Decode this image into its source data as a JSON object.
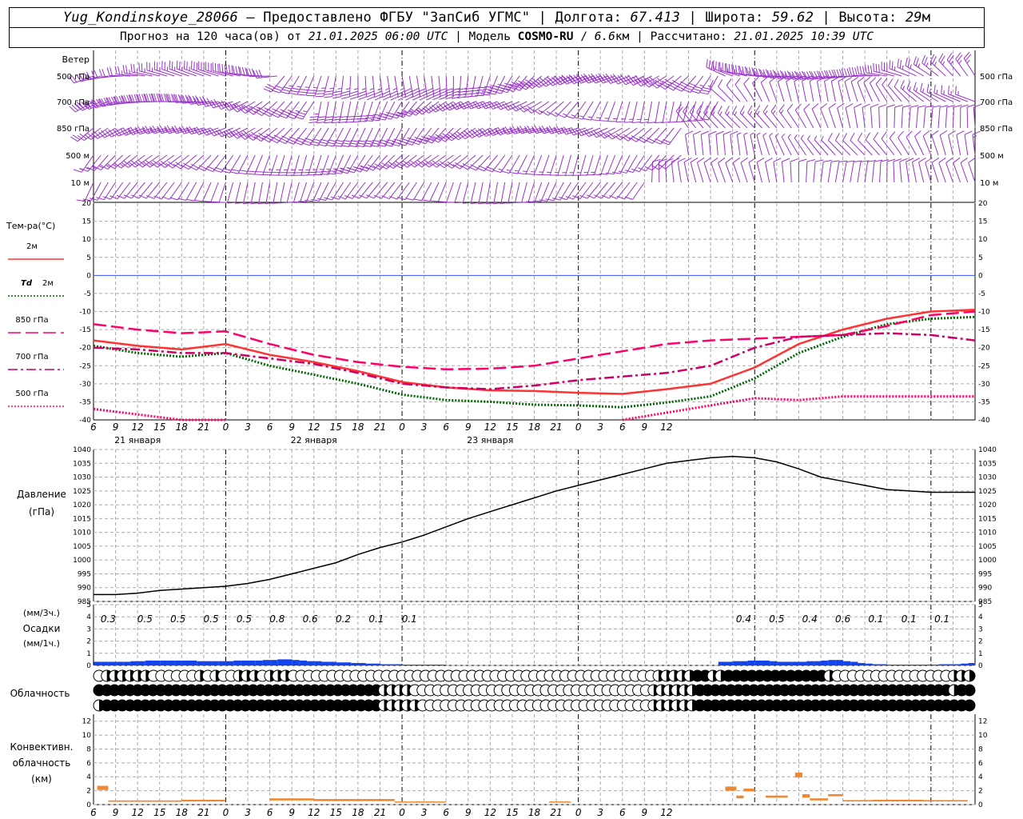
{
  "header": {
    "station": "Yug_Kondinskoye_28066",
    "dash": " – ",
    "provider": "Предоставлено ФГБУ \"ЗапСиб УГМС\"",
    "lon_label": "Долгота:",
    "lon": "67.413",
    "lat_label": "Широта:",
    "lat": "59.62",
    "alt_label": "Высота:",
    "alt": "29",
    "alt_unit": "м",
    "forecast_label": "Прогноз на 120 часа(ов) от",
    "issued": "21.01.2025 06:00 UTC",
    "model_label": "Модель",
    "model": "COSMO-RU",
    "resolution": "6.6",
    "res_unit": "км",
    "computed_label": "Рассчитано:",
    "computed": "21.01.2025 10:39 UTC"
  },
  "axis": {
    "hours_label": [
      "6",
      "9",
      "12",
      "15",
      "18",
      "21",
      "0",
      "3",
      "6",
      "9",
      "12",
      "15",
      "18",
      "21",
      "0",
      "3",
      "6",
      "9",
      "12",
      "15",
      "18",
      "21",
      "0",
      "3",
      "6",
      "9",
      "12"
    ],
    "day_labels": [
      "21 января",
      "22 января",
      "23 января"
    ]
  },
  "chart_data": [
    {
      "type": "wind_barbs",
      "title": "Ветер",
      "levels": [
        "500 гПа",
        "700 гПа",
        "850 гПа",
        "500 м",
        "10 м"
      ],
      "color": "#9933cc"
    },
    {
      "type": "line",
      "title": "Тем-ра(°C)",
      "ylim": [
        -40,
        20
      ],
      "yticks": [
        20,
        15,
        10,
        5,
        0,
        -5,
        -10,
        -15,
        -20,
        -25,
        -30,
        -35,
        -40
      ],
      "x_hours": [
        0,
        6,
        12,
        18,
        24,
        30,
        36,
        42,
        48,
        54,
        60,
        66,
        72,
        78,
        84,
        90,
        96,
        102,
        108,
        114,
        120
      ],
      "series": [
        {
          "name": "2м",
          "color": "#ff3333",
          "style": "solid",
          "values": [
            -18,
            -19.5,
            -20.5,
            -19,
            -22,
            -24,
            -26.5,
            -29.5,
            -31,
            -31.8,
            -32,
            -32.5,
            -32.8,
            -31.5,
            -30,
            -25.5,
            -19,
            -15,
            -12,
            -10,
            -9.5
          ]
        },
        {
          "name": "Td",
          "suffix": "2м",
          "color": "#006600",
          "style": "dotted",
          "values": [
            -19.5,
            -21.5,
            -22.5,
            -21.5,
            -25,
            -27.5,
            -30,
            -33,
            -34.5,
            -35,
            -35.8,
            -36,
            -36.5,
            -35.2,
            -33.5,
            -28.5,
            -21.5,
            -17,
            -13.5,
            -12,
            -11.5
          ]
        },
        {
          "name": "850 гПа",
          "color": "#ff0066",
          "style": "longdash",
          "values": [
            -13.5,
            -15,
            -16,
            -15.5,
            -19,
            -22,
            -24,
            -25.3,
            -26,
            -25.8,
            -25,
            -23,
            -21,
            -19,
            -18,
            -17.5,
            -17,
            -16.5,
            -14,
            -11,
            -10
          ]
        },
        {
          "name": "700 гПа",
          "color": "#cc0066",
          "style": "dashdot",
          "values": [
            -20,
            -20.5,
            -21.5,
            -21.5,
            -23,
            -24.5,
            -27,
            -30,
            -31,
            -31.5,
            -30.5,
            -29,
            -28,
            -27,
            -25,
            -20,
            -17,
            -16.5,
            -16,
            -16.5,
            -18
          ]
        },
        {
          "name": "500 гПа",
          "color": "#ff0066",
          "style": "dotted",
          "values": [
            -37,
            -38.5,
            -40,
            -40,
            null,
            null,
            null,
            null,
            null,
            null,
            null,
            null,
            -40,
            -38,
            -36,
            -34,
            -34.5,
            -33.5,
            -33.5,
            -33.5,
            -33.5
          ]
        }
      ]
    },
    {
      "type": "line",
      "title": "Давление",
      "unit": "(гПа)",
      "ylim": [
        985,
        1040
      ],
      "yticks": [
        1040,
        1035,
        1030,
        1025,
        1020,
        1015,
        1010,
        1005,
        1000,
        995,
        990,
        985
      ],
      "x_hours": [
        0,
        3,
        6,
        9,
        12,
        15,
        18,
        21,
        24,
        27,
        30,
        33,
        36,
        39,
        42,
        45,
        48,
        51,
        54,
        57,
        60,
        63,
        66,
        69,
        72,
        75,
        78,
        81,
        84,
        87,
        90,
        93,
        96,
        99,
        102,
        105,
        108,
        111,
        114,
        117,
        120
      ],
      "series": [
        {
          "name": "Давление",
          "color": "#000000",
          "values": [
            987.5,
            987.5,
            988,
            989,
            989.5,
            990,
            990.5,
            991.5,
            993,
            995,
            997,
            999,
            1002,
            1004.5,
            1006.5,
            1009,
            1012,
            1015,
            1017.5,
            1020,
            1022.5,
            1025,
            1027,
            1029,
            1031,
            1033,
            1035,
            1036,
            1037,
            1037.5,
            1037,
            1035.5,
            1033,
            1030,
            1028.5,
            1027,
            1025.5,
            1025,
            1024.5,
            1024.5,
            1024.5
          ]
        }
      ]
    },
    {
      "type": "bar",
      "title": "Осадки",
      "unit_3h": "(мм/3ч.)",
      "unit_1h": "(мм/1ч.)",
      "ylim": [
        0,
        5
      ],
      "yticks": [
        5,
        4,
        3,
        2,
        1,
        0
      ],
      "amounts_3h": [
        {
          "x": 2,
          "label": "0.3"
        },
        {
          "x": 7,
          "label": "0.5"
        },
        {
          "x": 11.5,
          "label": "0.5"
        },
        {
          "x": 16,
          "label": "0.5"
        },
        {
          "x": 20.5,
          "label": "0.5"
        },
        {
          "x": 25,
          "label": "0.8"
        },
        {
          "x": 29.5,
          "label": "0.6"
        },
        {
          "x": 34,
          "label": "0.2"
        },
        {
          "x": 38.5,
          "label": "0.1"
        },
        {
          "x": 43,
          "label": "0.1"
        },
        {
          "x": 88.5,
          "label": "0.4"
        },
        {
          "x": 93,
          "label": "0.5"
        },
        {
          "x": 97.5,
          "label": "0.4"
        },
        {
          "x": 102,
          "label": "0.6"
        },
        {
          "x": 106.5,
          "label": "0.1"
        },
        {
          "x": 111,
          "label": "0.1"
        },
        {
          "x": 115.5,
          "label": "0.1"
        }
      ],
      "color": "#1144ee",
      "x_hours": [
        1,
        2,
        3,
        4,
        5,
        6,
        7,
        8,
        9,
        10,
        11,
        12,
        13,
        14,
        15,
        16,
        17,
        18,
        19,
        20,
        21,
        22,
        23,
        24,
        25,
        26,
        27,
        28,
        29,
        30,
        31,
        32,
        33,
        34,
        35,
        36,
        37,
        38,
        39,
        40,
        41,
        42,
        43,
        44,
        45,
        46,
        47,
        48,
        86,
        87,
        88,
        89,
        90,
        91,
        92,
        93,
        94,
        95,
        96,
        97,
        98,
        99,
        100,
        101,
        102,
        103,
        104,
        105,
        106,
        107,
        108,
        109,
        110,
        111,
        112,
        113,
        114,
        115,
        116,
        117,
        118,
        119,
        120
      ],
      "values": [
        0.3,
        0.3,
        0.3,
        0.3,
        0.3,
        0.35,
        0.35,
        0.4,
        0.4,
        0.4,
        0.4,
        0.4,
        0.4,
        0.4,
        0.35,
        0.35,
        0.35,
        0.35,
        0.35,
        0.4,
        0.4,
        0.4,
        0.4,
        0.45,
        0.45,
        0.5,
        0.5,
        0.45,
        0.4,
        0.35,
        0.35,
        0.3,
        0.3,
        0.25,
        0.25,
        0.2,
        0.2,
        0.15,
        0.15,
        0.1,
        0.1,
        0.1,
        0.05,
        0.05,
        0.03,
        0.03,
        0.02,
        0.02,
        0.3,
        0.3,
        0.35,
        0.35,
        0.4,
        0.4,
        0.4,
        0.35,
        0.3,
        0.3,
        0.3,
        0.3,
        0.35,
        0.35,
        0.4,
        0.45,
        0.45,
        0.35,
        0.3,
        0.2,
        0.15,
        0.1,
        0.1,
        0.05,
        0.05,
        0.05,
        0.05,
        0.05,
        0.05,
        0.05,
        0.1,
        0.1,
        0.1,
        0.15,
        0.2
      ]
    },
    {
      "type": "cloud_symbols",
      "title": "Облачность",
      "rows": 3,
      "legend": "0 = ясно, 1 = частично (левая/правая половина), 2 = сплошная",
      "upper": [
        0,
        1,
        1,
        1,
        1,
        1,
        1,
        0,
        0,
        0,
        0,
        0,
        0,
        1,
        0,
        1,
        0,
        0,
        1,
        1,
        1,
        0,
        1,
        1,
        1,
        0,
        0,
        0,
        0,
        0,
        0,
        0,
        0,
        0,
        0,
        0,
        0,
        0,
        0,
        0,
        0,
        0,
        0,
        0,
        0,
        0,
        0,
        0,
        0,
        0,
        0,
        0,
        0,
        0,
        0,
        0,
        0,
        0,
        0,
        0,
        0,
        0,
        0,
        0,
        0,
        0,
        0,
        0,
        0,
        0,
        0,
        0,
        1,
        1,
        1,
        1,
        1,
        2,
        2,
        1,
        1,
        2,
        2,
        2,
        2,
        2,
        2,
        2,
        2,
        2,
        2,
        2,
        2,
        2,
        1,
        0,
        0,
        0,
        0,
        0,
        0,
        0,
        0,
        0,
        0,
        0,
        0,
        0,
        0,
        0,
        1,
        1,
        1
      ],
      "middle": [
        2,
        2,
        2,
        2,
        2,
        2,
        2,
        2,
        2,
        2,
        2,
        2,
        2,
        2,
        2,
        2,
        2,
        2,
        2,
        2,
        2,
        2,
        2,
        2,
        2,
        2,
        2,
        2,
        2,
        2,
        2,
        2,
        2,
        2,
        2,
        2,
        2,
        1,
        1,
        1,
        1,
        0,
        0,
        0,
        0,
        0,
        0,
        0,
        0,
        0,
        0,
        0,
        0,
        0,
        0,
        0,
        0,
        0,
        0,
        0,
        0,
        0,
        0,
        0,
        0,
        0,
        0,
        0,
        0,
        0,
        0,
        0,
        1,
        1,
        1,
        1,
        1,
        1,
        2,
        2,
        2,
        2,
        2,
        2,
        2,
        2,
        2,
        2,
        2,
        2,
        2,
        2,
        2,
        2,
        2,
        2,
        2,
        2,
        2,
        2,
        2,
        2,
        2,
        2,
        2,
        2,
        2,
        2,
        2,
        2,
        2,
        1,
        2,
        2
      ],
      "lower": [
        1,
        2,
        2,
        2,
        2,
        2,
        2,
        2,
        2,
        2,
        2,
        2,
        2,
        2,
        2,
        2,
        2,
        2,
        2,
        2,
        2,
        2,
        2,
        2,
        2,
        2,
        2,
        2,
        2,
        2,
        2,
        2,
        2,
        2,
        2,
        2,
        2,
        1,
        1,
        1,
        1,
        1,
        0,
        0,
        0,
        0,
        0,
        0,
        0,
        0,
        0,
        0,
        0,
        0,
        0,
        0,
        0,
        0,
        0,
        0,
        0,
        0,
        0,
        0,
        0,
        0,
        0,
        0,
        0,
        0,
        0,
        0,
        1,
        1,
        1,
        1,
        1,
        1,
        2,
        2,
        2,
        2,
        2,
        2,
        2,
        2,
        2,
        2,
        2,
        2,
        2,
        2,
        2,
        2,
        2,
        2,
        2,
        2,
        2,
        2,
        2,
        2,
        2,
        2,
        2,
        2,
        2,
        2,
        2,
        2,
        2,
        2,
        2,
        2
      ]
    },
    {
      "type": "bar",
      "title": "Конвективн. облачность",
      "unit": "(км)",
      "ylim": [
        0,
        13
      ],
      "yticks": [
        12,
        10,
        8,
        6,
        4,
        2,
        0
      ],
      "color": "#ee8833",
      "segments": [
        {
          "x0": 0.5,
          "x1": 2,
          "bottom": 2.1,
          "top": 2.7
        },
        {
          "x0": 2,
          "x1": 12,
          "bottom": 0.4,
          "top": 0.6
        },
        {
          "x0": 12,
          "x1": 18,
          "bottom": 0.45,
          "top": 0.7
        },
        {
          "x0": 24,
          "x1": 30,
          "bottom": 0.6,
          "top": 0.9
        },
        {
          "x0": 30,
          "x1": 41,
          "bottom": 0.5,
          "top": 0.8
        },
        {
          "x0": 41,
          "x1": 48,
          "bottom": 0.3,
          "top": 0.45
        },
        {
          "x0": 62,
          "x1": 65,
          "bottom": 0.3,
          "top": 0.45
        },
        {
          "x0": 86,
          "x1": 87.5,
          "bottom": 2.0,
          "top": 2.6
        },
        {
          "x0": 87.5,
          "x1": 88.5,
          "bottom": 0.9,
          "top": 1.3
        },
        {
          "x0": 88.5,
          "x1": 90,
          "bottom": 1.9,
          "top": 2.3
        },
        {
          "x0": 91.5,
          "x1": 94.5,
          "bottom": 1.0,
          "top": 1.3
        },
        {
          "x0": 95.5,
          "x1": 96.5,
          "bottom": 3.9,
          "top": 4.6
        },
        {
          "x0": 96.5,
          "x1": 97.5,
          "bottom": 1.0,
          "top": 1.5
        },
        {
          "x0": 97.5,
          "x1": 100,
          "bottom": 0.6,
          "top": 0.9
        },
        {
          "x0": 100,
          "x1": 102,
          "bottom": 1.2,
          "top": 1.5
        },
        {
          "x0": 102,
          "x1": 106,
          "bottom": 0.45,
          "top": 0.65
        },
        {
          "x0": 106,
          "x1": 113,
          "bottom": 0.45,
          "top": 0.7
        },
        {
          "x0": 113,
          "x1": 119,
          "bottom": 0.45,
          "top": 0.65
        }
      ]
    }
  ]
}
